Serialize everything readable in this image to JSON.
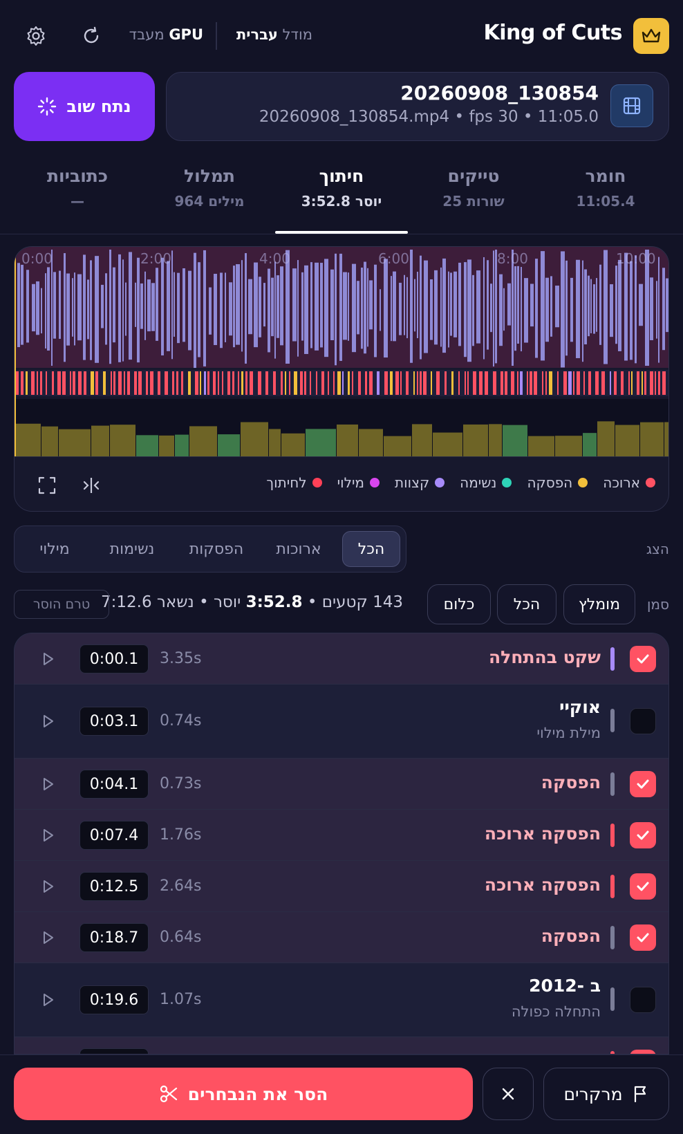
{
  "header": {
    "app_title": "King of Cuts",
    "model_label": "מודל",
    "model_value": "עברית",
    "processor_label": "מעבד",
    "processor_value": "GPU",
    "icons": [
      "crown-icon",
      "refresh-icon",
      "gear-icon"
    ],
    "logo_color": "#f2bf3b"
  },
  "file": {
    "title": "20260908_130854",
    "meta": "20260908_130854.mp4 • fps 30 • 11:05.0",
    "icon": "film-icon"
  },
  "reanalyze": {
    "label": "נתח שוב",
    "icon": "loader-icon",
    "color": "#7b2ff3"
  },
  "tabs": [
    {
      "label": "חומר",
      "sub": "11:05.4"
    },
    {
      "label": "טייקים",
      "sub": "25 שורות"
    },
    {
      "label": "חיתוך",
      "sub": "3:52.8 יוסר",
      "active": true
    },
    {
      "label": "תמלול",
      "sub": "964 מילים"
    },
    {
      "label": "כתוביות",
      "sub": "—"
    }
  ],
  "timeline": {
    "ticks": [
      "0:00",
      "2:00",
      "4:00",
      "6:00",
      "8:00",
      "10:00"
    ],
    "legend": [
      {
        "label": "ארוכה",
        "color": "#ff5263"
      },
      {
        "label": "הפסקה",
        "color": "#f2bf3b"
      },
      {
        "label": "נשימה",
        "color": "#2ed3b7"
      },
      {
        "label": "קצוות",
        "color": "#a78bfa"
      },
      {
        "label": "מילוי",
        "color": "#d946ef"
      },
      {
        "label": "לחיתוך",
        "color": "#ff4057"
      }
    ],
    "tools": [
      "split-icon",
      "fullscreen-icon"
    ]
  },
  "filters": {
    "label": "הצג",
    "options": [
      "הכל",
      "ארוכות",
      "הפסקות",
      "נשימות",
      "מילוי"
    ],
    "active_index": 0
  },
  "select_row": {
    "label": "סמן",
    "buttons": [
      "מומלץ",
      "הכל",
      "כלום"
    ],
    "stats_count": "143 קטעים •",
    "stats_removed": "3:52.8",
    "stats_rest": "יוסר • נשאר 7:12.6",
    "pending_badge": "טרם הוסר"
  },
  "rows": [
    {
      "title": "שקט בהתחלה",
      "sub": "",
      "duration": "3.35s",
      "time": "0:00.1",
      "checked": true,
      "bar_color": "#a78bfa"
    },
    {
      "title": "אוקיי",
      "sub": "מילת מילוי",
      "duration": "0.74s",
      "time": "0:03.1",
      "checked": false,
      "bar_color": "#7b7d98"
    },
    {
      "title": "הפסקה",
      "sub": "",
      "duration": "0.73s",
      "time": "0:04.1",
      "checked": true,
      "bar_color": "#7b7d98"
    },
    {
      "title": "הפסקה ארוכה",
      "sub": "",
      "duration": "1.76s",
      "time": "0:07.4",
      "checked": true,
      "bar_color": "#ff5263"
    },
    {
      "title": "הפסקה ארוכה",
      "sub": "",
      "duration": "2.64s",
      "time": "0:12.5",
      "checked": true,
      "bar_color": "#ff5263"
    },
    {
      "title": "הפסקה",
      "sub": "",
      "duration": "0.64s",
      "time": "0:18.7",
      "checked": true,
      "bar_color": "#7b7d98"
    },
    {
      "title": "ב -2012",
      "sub": "התחלה כפולה",
      "duration": "1.07s",
      "time": "0:19.6",
      "checked": false,
      "bar_color": "#7b7d98"
    }
  ],
  "bottom": {
    "remove_label": "הסר את הנבחרים",
    "markers_label": "מרקרים",
    "icons": [
      "scissors-icon",
      "close-icon",
      "flag-icon"
    ]
  }
}
